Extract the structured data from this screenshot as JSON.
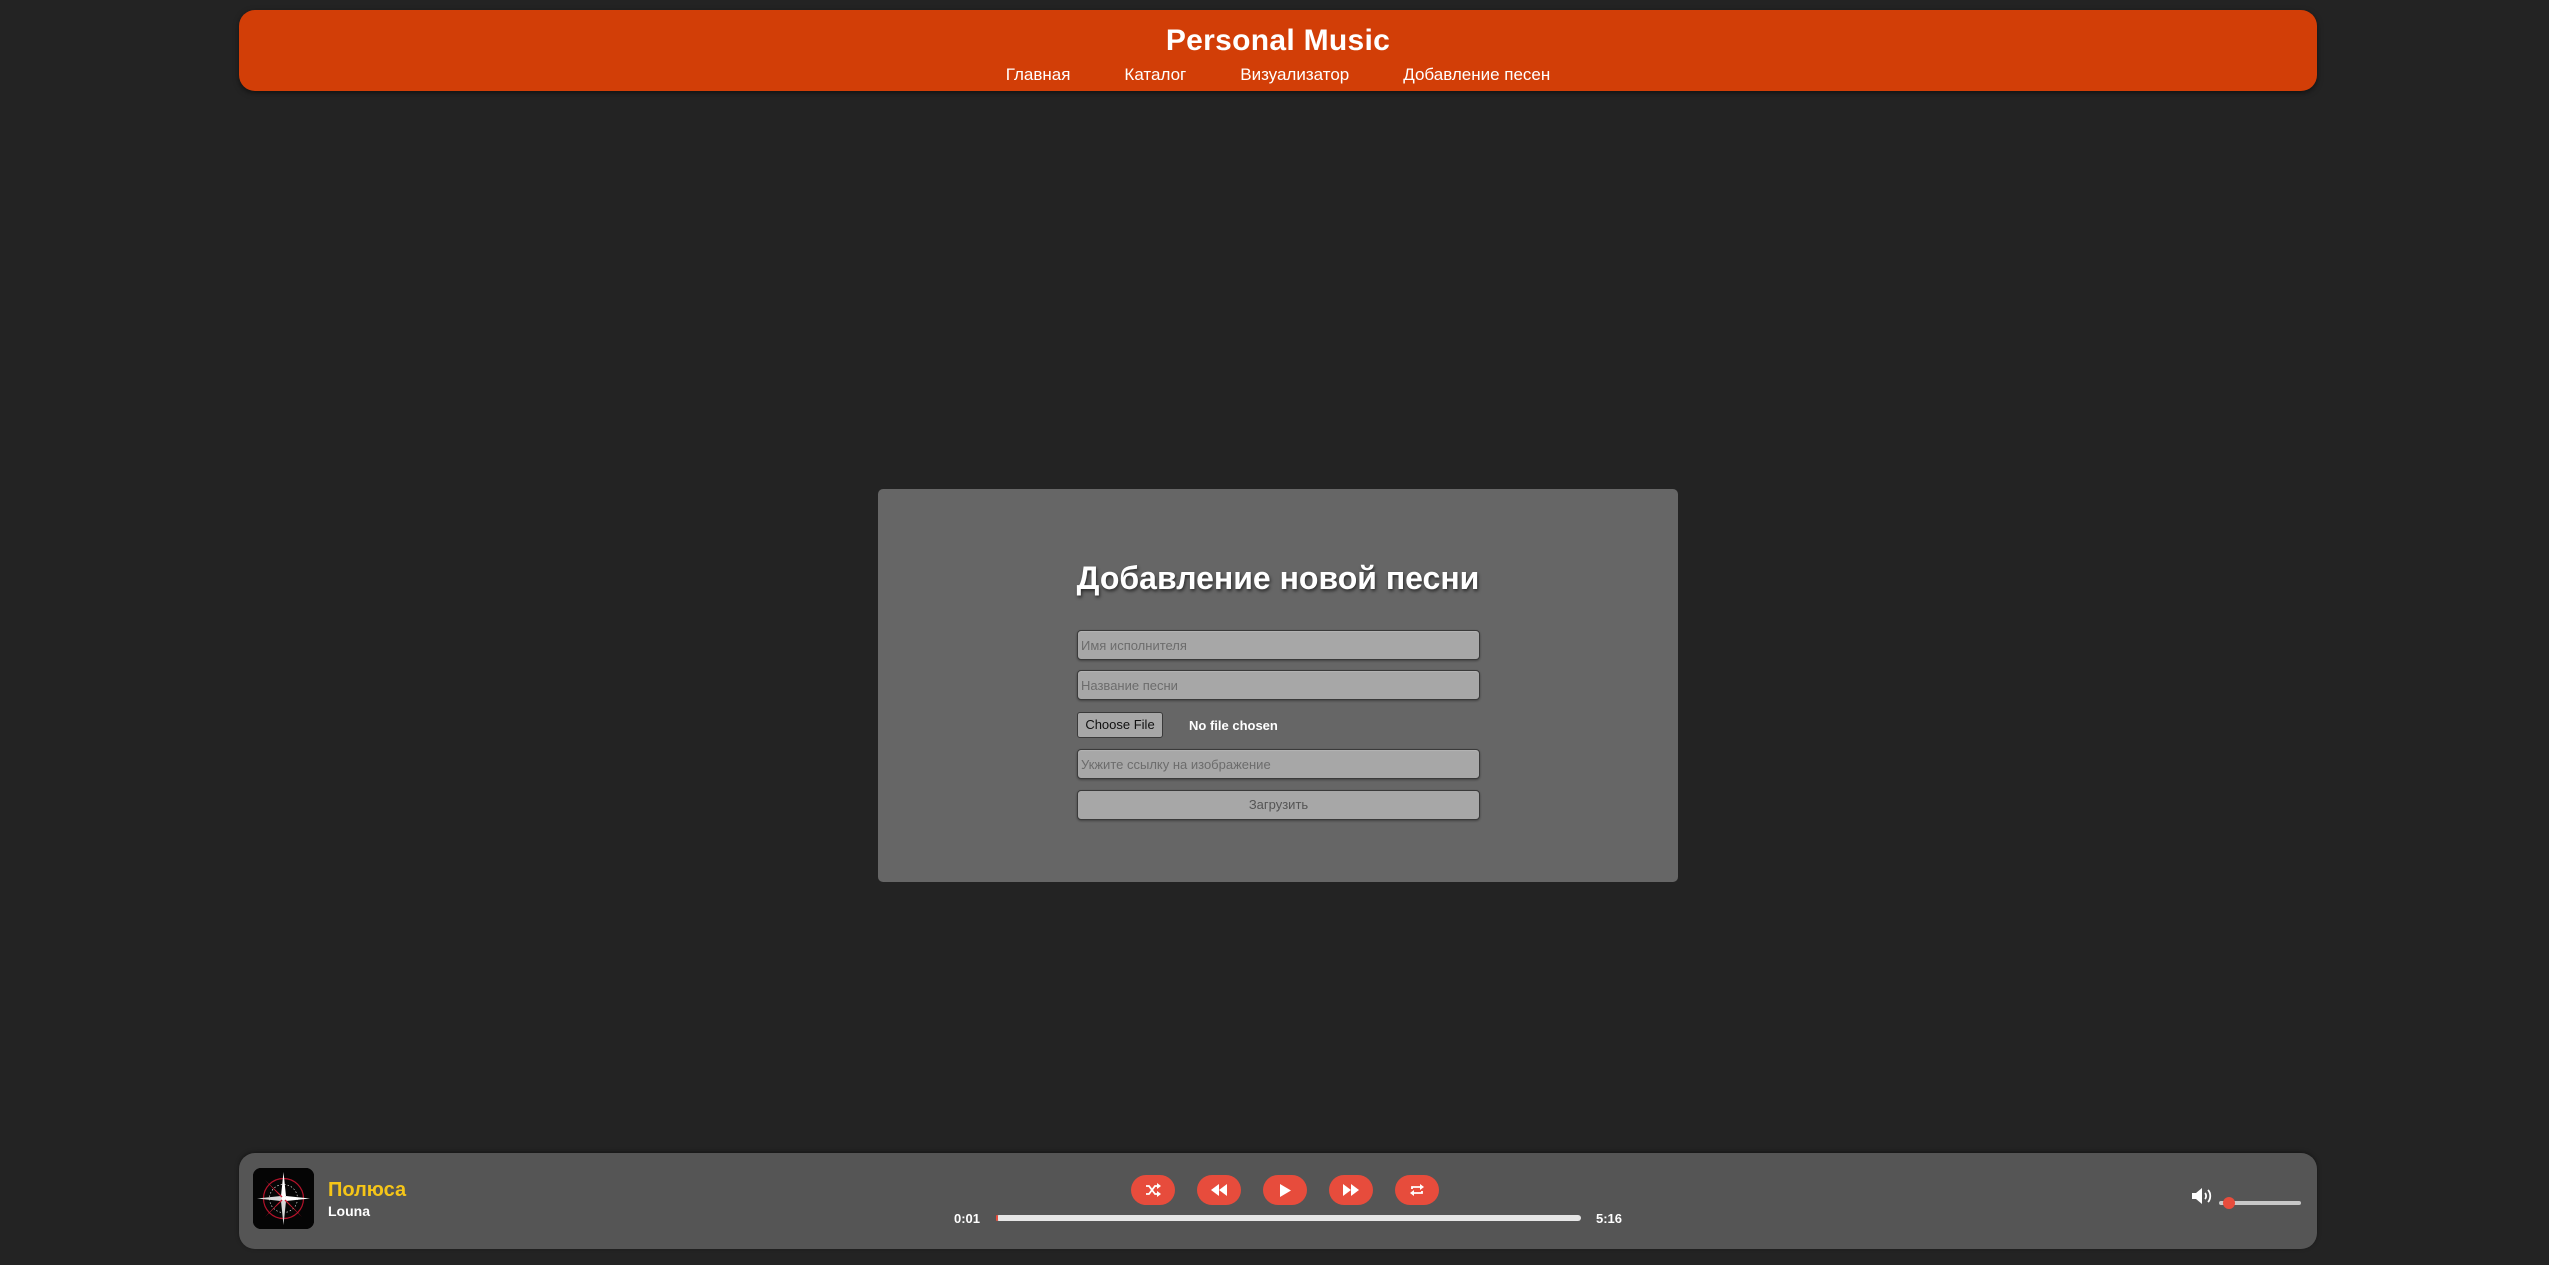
{
  "header": {
    "title": "Personal Music",
    "nav": [
      "Главная",
      "Каталог",
      "Визуализатор",
      "Добавление песен"
    ],
    "color": "#d23e07"
  },
  "upload_form": {
    "title": "Добавление новой песни",
    "artist_placeholder": "Имя исполнителя",
    "song_placeholder": "Название песни",
    "file_button": "Choose File",
    "file_status": "No file chosen",
    "image_placeholder": "Укжите ссылку на изображение",
    "submit_label": "Загрузить"
  },
  "player": {
    "track_title": "Полюса",
    "artist": "Louna",
    "current_time": "0:01",
    "duration": "5:16",
    "progress_fraction": 0.003,
    "volume_fraction": 0.12,
    "controls": [
      "shuffle-icon",
      "rewind-icon",
      "play-icon",
      "fast-forward-icon",
      "repeat-icon"
    ],
    "accent_color": "#e74c3c",
    "title_color": "#f5c518"
  }
}
